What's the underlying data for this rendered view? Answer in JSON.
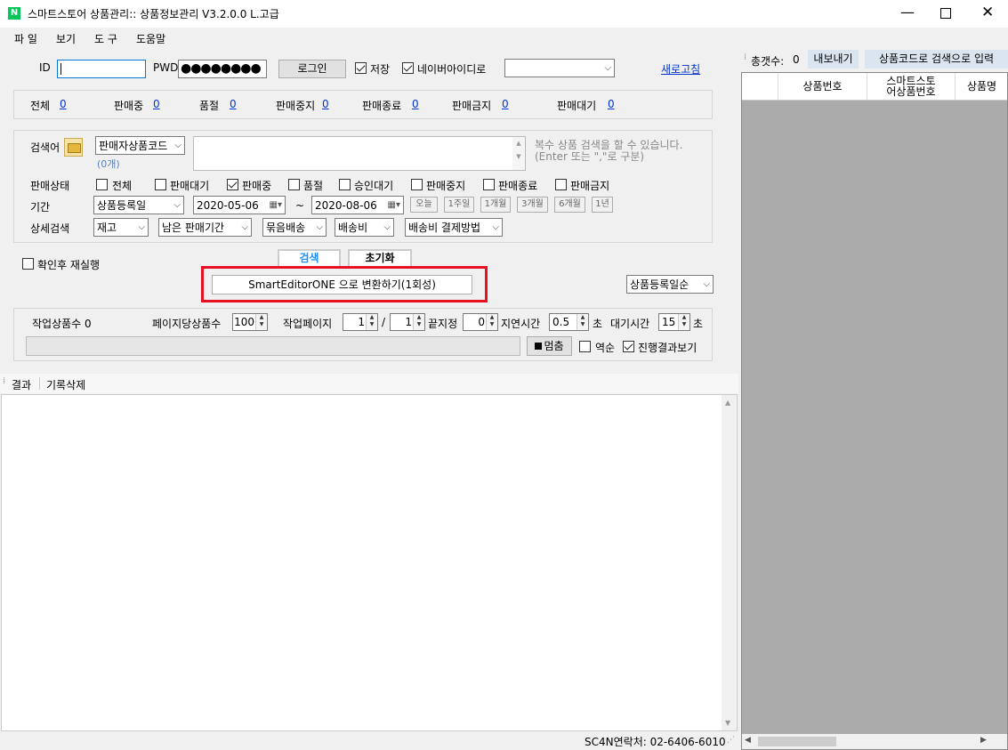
{
  "window": {
    "title": "스마트스토어 상품관리:: 상품정보관리 V3.2.0.0 L.고급"
  },
  "menu": [
    "파 일",
    "보기",
    "도 구",
    "도움말"
  ],
  "login": {
    "id_label": "ID",
    "id_value": "",
    "pwd_label": "PWD",
    "pwd_value": "●●●●●●●●",
    "login_button": "로그인",
    "save_label": "저장",
    "naver_id_label": "네이버아이디로",
    "naver_id_value": "",
    "refresh_link": "새로고침"
  },
  "status": [
    {
      "label": "전체",
      "count": "0"
    },
    {
      "label": "판매중",
      "count": "0"
    },
    {
      "label": "품절",
      "count": "0"
    },
    {
      "label": "판매중지",
      "count": "0"
    },
    {
      "label": "판매종료",
      "count": "0"
    },
    {
      "label": "판매금지",
      "count": "0"
    },
    {
      "label": "판매대기",
      "count": "0"
    }
  ],
  "search": {
    "keyword_label": "검색어",
    "type_select": "판매자상품코드",
    "count_label": "(0개)",
    "hint": "복수 상품 검색을 할 수 있습니다.\n(Enter 또는 \",\"로 구분)",
    "sale_state_label": "판매상태",
    "states": [
      {
        "label": "전체",
        "checked": false
      },
      {
        "label": "판매대기",
        "checked": false
      },
      {
        "label": "판매중",
        "checked": true
      },
      {
        "label": "품절",
        "checked": false
      },
      {
        "label": "승인대기",
        "checked": false
      },
      {
        "label": "판매중지",
        "checked": false
      },
      {
        "label": "판매종료",
        "checked": false
      },
      {
        "label": "판매금지",
        "checked": false
      }
    ],
    "period_label": "기간",
    "period_type": "상품등록일",
    "date_from": "2020-05-06",
    "tilde": "~",
    "date_to": "2020-08-06",
    "quick_ranges": [
      "오늘",
      "1주일",
      "1개월",
      "3개월",
      "6개월",
      "1년"
    ],
    "detail_label": "상세검색",
    "detail_selects": [
      "재고",
      "남은 판매기간",
      "묶음배송",
      "배송비",
      "배송비 결제방법"
    ]
  },
  "actions": {
    "confirm_rerun": "확인후 재실행",
    "search_button": "검색",
    "reset_button": "초기화",
    "convert_button": "SmartEditorONE 으로 변환하기(1회성)",
    "sort_select": "상품등록일순"
  },
  "work": {
    "count_label": "작업상품수 0",
    "per_page_label": "페이지당상품수",
    "per_page": "100",
    "work_page_label": "작업페이지",
    "page_from": "1",
    "slash": "/",
    "page_to": "1",
    "end_label": "끝지정",
    "end_value": "0",
    "delay_label": "지연시간",
    "delay_value": "0.5",
    "sec1": "초",
    "wait_label": "대기시간",
    "wait_value": "15",
    "sec2": "초",
    "stop_button": "멈춤",
    "reverse_label": "역순",
    "show_progress_label": "진행결과보기"
  },
  "result_tabs": [
    "결과",
    "기록삭제"
  ],
  "footer": {
    "contact": "SC4N연락처: 02-6406-6010"
  },
  "right_panel": {
    "total_label": "총갯수:",
    "total_value": "0",
    "export_button": "내보내기",
    "to_search_button": "상품코드로 검색으로 입력",
    "columns": [
      "상품번호",
      "스마트스토\n어상품번호",
      "상품명"
    ]
  },
  "colors": {
    "highlight": "#e81123",
    "link": "#0033cc"
  }
}
